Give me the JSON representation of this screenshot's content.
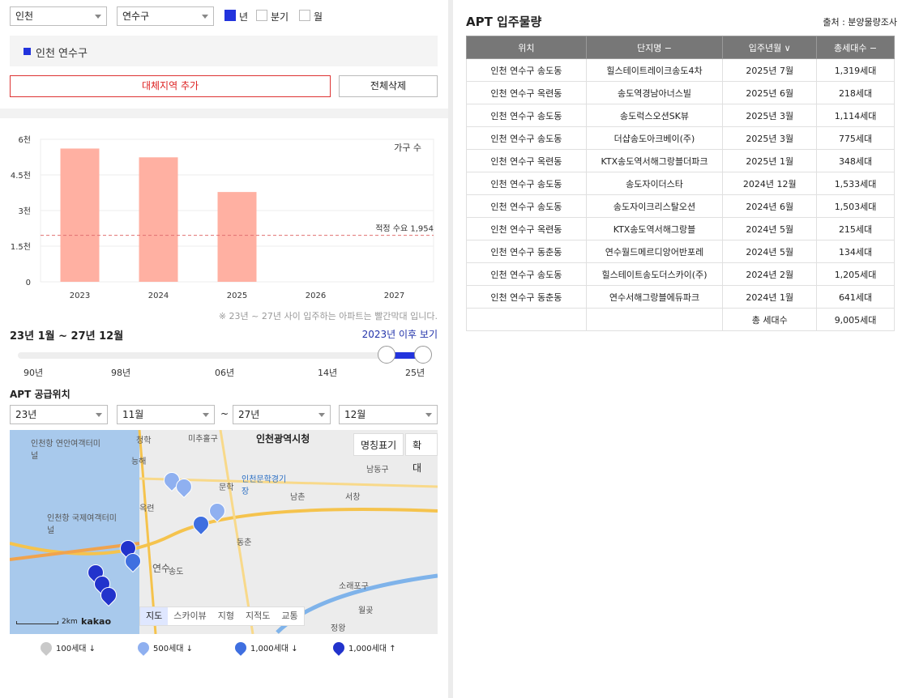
{
  "filters": {
    "region1": "인천",
    "region2": "연수구",
    "period_options": [
      {
        "label": "년",
        "checked": true
      },
      {
        "label": "분기",
        "checked": false
      },
      {
        "label": "월",
        "checked": false
      }
    ]
  },
  "selected_region": "인천 연수구",
  "buttons": {
    "add_region": "대체지역 추가",
    "delete_all": "전체삭제"
  },
  "chart_data": {
    "type": "bar",
    "categories": [
      "2023",
      "2024",
      "2025",
      "2026",
      "2027"
    ],
    "values": [
      5610,
      5240,
      3780,
      0,
      0
    ],
    "y_ticks": [
      "6천",
      "4.5천",
      "3천",
      "1.5천",
      "0"
    ],
    "ylim": [
      0,
      6000
    ],
    "legend": "가구 수",
    "reference_line": {
      "label": "적정 수요 1,954",
      "value": 1954
    },
    "bar_color": "#ffb0a2",
    "line_color": "#e07070"
  },
  "chart_note": "※ 23년 ~ 27년 사이 입주하는 아파트는 빨간막대 입니다.",
  "range_text": "23년 1월 ~ 27년 12월",
  "after_2023_link": "2023년 이후 보기",
  "slider": {
    "ticks": [
      "90년",
      "98년",
      "06년",
      "14년",
      "25년"
    ],
    "range_start": 0.91,
    "range_end": 1.0
  },
  "supply_title": "APT 공급위치",
  "period_selects": {
    "start_year": "23년",
    "start_month": "11월",
    "tilde": "~",
    "end_year": "27년",
    "end_month": "12월"
  },
  "map": {
    "btn_names": "명칭표기",
    "btn_zoom": "확대",
    "tabs": [
      "지도",
      "스카이뷰",
      "지형",
      "지적도",
      "교통"
    ],
    "labels": [
      "인천광역시청",
      "인천항 연안여객터미널",
      "인천항 국제여객터미널",
      "인천문학경기장",
      "문학",
      "옥련",
      "연수",
      "송도",
      "남동구",
      "소래포구",
      "서창",
      "남촌",
      "월곶",
      "정왕",
      "미추홀구",
      "능해",
      "청학",
      "동춘"
    ],
    "scale": "2km",
    "brand": "kakao"
  },
  "map_legend": [
    {
      "label": "100세대 ↓",
      "color": "#c9c9c9"
    },
    {
      "label": "500세대 ↓",
      "color": "#8fb0f0"
    },
    {
      "label": "1,000세대 ↓",
      "color": "#3f6fe0"
    },
    {
      "label": "1,000세대 ↑",
      "color": "#2233cc"
    }
  ],
  "table": {
    "title": "APT 입주물량",
    "source": "출처 : 분양물량조사",
    "headers": [
      "위치",
      "단지명 −",
      "입주년월 ∨",
      "총세대수 −"
    ],
    "rows": [
      [
        "인천 연수구 송도동",
        "힐스테이트레이크송도4차",
        "2025년 7월",
        "1,319세대"
      ],
      [
        "인천 연수구 옥련동",
        "송도역경남아너스빌",
        "2025년 6월",
        "218세대"
      ],
      [
        "인천 연수구 송도동",
        "송도럭스오션SK뷰",
        "2025년 3월",
        "1,114세대"
      ],
      [
        "인천 연수구 송도동",
        "더샵송도아크베이(주)",
        "2025년 3월",
        "775세대"
      ],
      [
        "인천 연수구 옥련동",
        "KTX송도역서해그랑블더파크",
        "2025년 1월",
        "348세대"
      ],
      [
        "인천 연수구 송도동",
        "송도자이더스타",
        "2024년 12월",
        "1,533세대"
      ],
      [
        "인천 연수구 송도동",
        "송도자이크리스탈오션",
        "2024년 6월",
        "1,503세대"
      ],
      [
        "인천 연수구 옥련동",
        "KTX송도역서해그랑블",
        "2024년 5월",
        "215세대"
      ],
      [
        "인천 연수구 동춘동",
        "연수월드메르디앙어반포레",
        "2024년 5월",
        "134세대"
      ],
      [
        "인천 연수구 송도동",
        "힐스테이트송도더스카이(주)",
        "2024년 2월",
        "1,205세대"
      ],
      [
        "인천 연수구 동춘동",
        "연수서해그랑블에듀파크",
        "2024년 1월",
        "641세대"
      ]
    ],
    "total_label": "총 세대수",
    "total_value": "9,005세대"
  }
}
